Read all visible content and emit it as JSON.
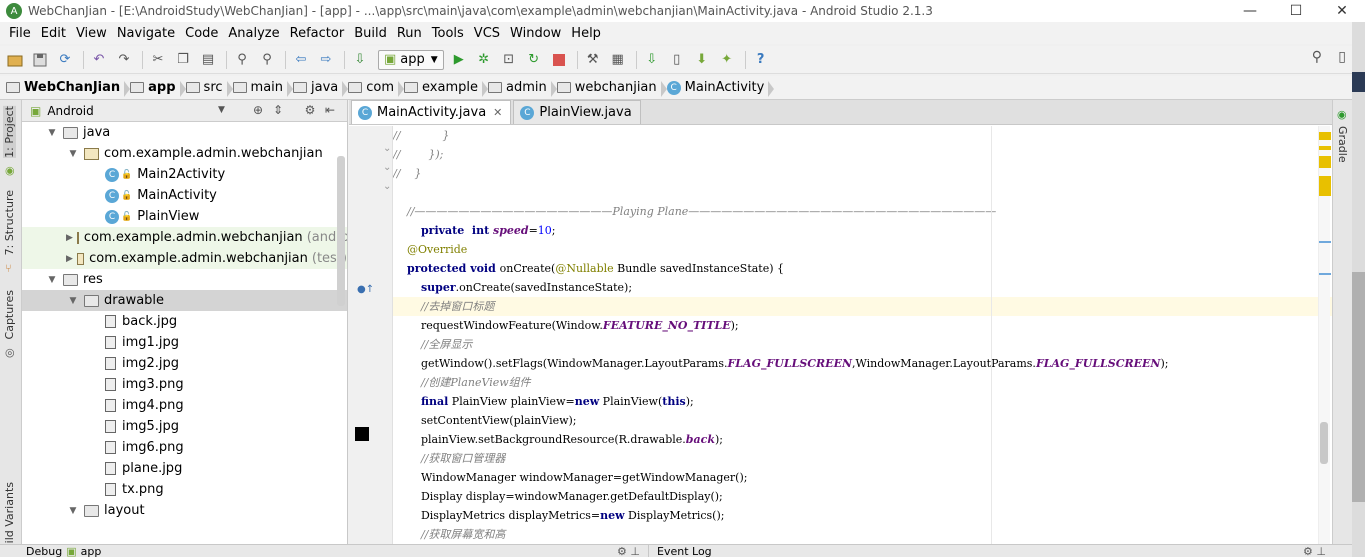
{
  "window": {
    "title": "WebChanJian - [E:\\AndroidStudy\\WebChanJian] - [app] - ...\\app\\src\\main\\java\\com\\example\\admin\\webchanjian\\MainActivity.java - Android Studio 2.1.3",
    "minimize_icon": "—",
    "maximize_icon": "☐",
    "close_icon": "✕"
  },
  "menu": [
    "File",
    "Edit",
    "View",
    "Navigate",
    "Code",
    "Analyze",
    "Refactor",
    "Build",
    "Run",
    "Tools",
    "VCS",
    "Window",
    "Help"
  ],
  "toolbar": {
    "run_config": "app",
    "help_glyph": "?"
  },
  "breadcrumbs": [
    "WebChanJian",
    "app",
    "src",
    "main",
    "java",
    "com",
    "example",
    "admin",
    "webchanjian",
    "MainActivity"
  ],
  "left_tabs": {
    "project": "1: Project",
    "structure": "7: Structure",
    "captures": "Captures",
    "build_variants": "Build Variants"
  },
  "project_panel": {
    "view": "Android",
    "tree": [
      {
        "label": "java",
        "type": "folder",
        "arrow": "▼",
        "indent": 1
      },
      {
        "label": "com.example.admin.webchanjian",
        "type": "pkg",
        "arrow": "▼",
        "indent": 2
      },
      {
        "label": "Main2Activity",
        "type": "class",
        "indent": 3
      },
      {
        "label": "MainActivity",
        "type": "class",
        "indent": 3
      },
      {
        "label": "PlainView",
        "type": "class",
        "indent": 3
      },
      {
        "label": "com.example.admin.webchanjian",
        "suffix": "(andro",
        "type": "pkg",
        "arrow": "▶",
        "indent": 2,
        "green": true
      },
      {
        "label": "com.example.admin.webchanjian",
        "suffix": "(test)",
        "type": "pkg",
        "arrow": "▶",
        "indent": 2,
        "green": true
      },
      {
        "label": "res",
        "type": "folder",
        "arrow": "▼",
        "indent": 1
      },
      {
        "label": "drawable",
        "type": "folder",
        "arrow": "▼",
        "indent": 2,
        "selected": true
      },
      {
        "label": "back.jpg",
        "type": "file",
        "indent": 3
      },
      {
        "label": "img1.jpg",
        "type": "file",
        "indent": 3
      },
      {
        "label": "img2.jpg",
        "type": "file",
        "indent": 3
      },
      {
        "label": "img3.png",
        "type": "file",
        "indent": 3
      },
      {
        "label": "img4.png",
        "type": "file",
        "indent": 3
      },
      {
        "label": "img5.jpg",
        "type": "file",
        "indent": 3
      },
      {
        "label": "img6.png",
        "type": "file",
        "indent": 3
      },
      {
        "label": "plane.jpg",
        "type": "file",
        "indent": 3
      },
      {
        "label": "tx.png",
        "type": "file",
        "indent": 3
      },
      {
        "label": "layout",
        "type": "folder",
        "arrow": "▼",
        "indent": 2
      }
    ]
  },
  "tabs": [
    {
      "label": "MainActivity.java",
      "active": true,
      "close": "✕"
    },
    {
      "label": "PlainView.java",
      "active": false
    }
  ],
  "code": [
    [
      [
        "c-comment",
        "//            }"
      ]
    ],
    [
      [
        "c-comment",
        "//        });"
      ]
    ],
    [
      [
        "c-comment",
        "//    }"
      ]
    ],
    [],
    [
      [
        "c-comment",
        "    //——————————————————Playing Plane————————————————————————————"
      ]
    ],
    [
      [
        "c-plain",
        "        "
      ],
      [
        "c-kw",
        "private  int "
      ],
      [
        "c-field",
        "speed"
      ],
      [
        "c-plain",
        "="
      ],
      [
        "c-num",
        "10"
      ],
      [
        "c-plain",
        ";"
      ]
    ],
    [
      [
        "c-ann",
        "    @Override"
      ]
    ],
    [
      [
        "c-plain",
        "    "
      ],
      [
        "c-kw",
        "protected void "
      ],
      [
        "c-plain",
        "onCreate("
      ],
      [
        "c-ann",
        "@Nullable"
      ],
      [
        "c-plain",
        " Bundle savedInstanceState) {"
      ]
    ],
    [
      [
        "c-plain",
        "        "
      ],
      [
        "c-kw",
        "super"
      ],
      [
        "c-plain",
        ".onCreate(savedInstanceState);"
      ]
    ],
    [
      [
        "c-comment",
        "        //去掉窗口标题"
      ]
    ],
    [
      [
        "c-plain",
        "        requestWindowFeature(Window."
      ],
      [
        "c-field",
        "FEATURE_NO_TITLE"
      ],
      [
        "c-plain",
        ");"
      ]
    ],
    [
      [
        "c-comment",
        "        //全屏显示"
      ]
    ],
    [
      [
        "c-plain",
        "        getWindow().setFlags(WindowManager.LayoutParams."
      ],
      [
        "c-field",
        "FLAG_FULLSCREEN"
      ],
      [
        "c-plain",
        ",WindowManager.LayoutParams."
      ],
      [
        "c-field",
        "FLAG_FULLSCREEN"
      ],
      [
        "c-plain",
        ");"
      ]
    ],
    [
      [
        "c-comment",
        "        //创建PlaneView组件"
      ]
    ],
    [
      [
        "c-plain",
        "        "
      ],
      [
        "c-kw",
        "final"
      ],
      [
        "c-plain",
        " PlainView plainView="
      ],
      [
        "c-kw",
        "new"
      ],
      [
        "c-plain",
        " PlainView("
      ],
      [
        "c-kw",
        "this"
      ],
      [
        "c-plain",
        ");"
      ]
    ],
    [
      [
        "c-plain",
        "        setContentView(plainView);"
      ]
    ],
    [
      [
        "c-plain",
        "        plainView.setBackgroundResource(R.drawable."
      ],
      [
        "c-field",
        "back"
      ],
      [
        "c-plain",
        ");"
      ]
    ],
    [
      [
        "c-comment",
        "        //获取窗口管理器"
      ]
    ],
    [
      [
        "c-plain",
        "        WindowManager windowManager=getWindowManager();"
      ]
    ],
    [
      [
        "c-plain",
        "        Display display=windowManager.getDefaultDisplay();"
      ]
    ],
    [
      [
        "c-plain",
        "        DisplayMetrics displayMetrics="
      ],
      [
        "c-kw",
        "new"
      ],
      [
        "c-plain",
        " DisplayMetrics();"
      ]
    ],
    [
      [
        "c-comment",
        "        //获取屏幕宽和高"
      ]
    ]
  ],
  "right_tab": "Gradle",
  "bottom": {
    "debug_label": "Debug",
    "debug_config": "app",
    "event_log": "Event Log"
  },
  "colors": {
    "stripe_warning": "#e8c000",
    "stripe_info": "#6fa8dc"
  }
}
